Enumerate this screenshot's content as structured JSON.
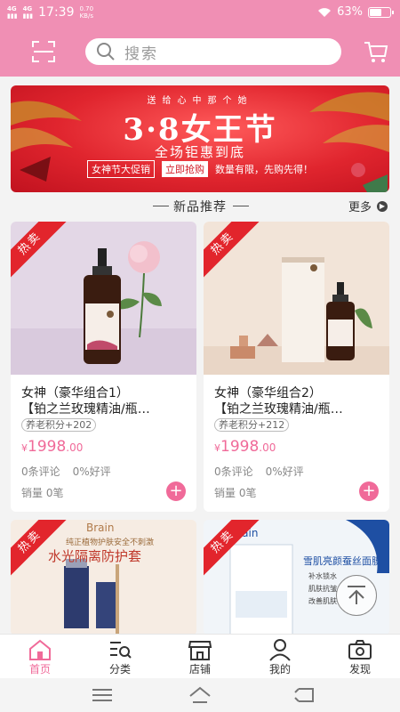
{
  "status_bar": {
    "network1": "4G",
    "network2": "4G",
    "time": "17:39",
    "speed_value": "0.70",
    "speed_unit": "KB/s",
    "battery": "63%",
    "battery_level": 0.63
  },
  "header": {
    "search_placeholder": "搜索",
    "scan_icon": "scan-icon",
    "cart_icon": "cart-icon"
  },
  "banner": {
    "top_text": "送给心中那个她",
    "title": "3·8女王节",
    "subtitle": "全场钜惠到底",
    "promo_label": "女神节大促销",
    "buy_label": "立即抢购",
    "limit_text": "数量有限，先购先得！"
  },
  "section": {
    "title": "新品推荐",
    "more": "更多"
  },
  "products": [
    {
      "badge": "热卖",
      "name_line1": "女神（豪华组合1）",
      "name_line2": "【铂之兰玫瑰精油/瓶…",
      "points": "养老积分+202",
      "currency": "¥",
      "price_int": "1998",
      "price_dec": ".00",
      "comments": "0条评论",
      "good_rate": "0%好评",
      "sales": "销量 0笔"
    },
    {
      "badge": "热卖",
      "name_line1": "女神（豪华组合2）",
      "name_line2": "【铂之兰玫瑰精油/瓶…",
      "points": "养老积分+212",
      "currency": "¥",
      "price_int": "1998",
      "price_dec": ".00",
      "comments": "0条评论",
      "good_rate": "0%好评",
      "sales": "销量 0笔"
    }
  ],
  "bottom_cards": [
    {
      "badge": "热卖",
      "brand": "Brain",
      "line1": "纯正植物护肤安全不刺激",
      "headline": "水光隔离防护套"
    },
    {
      "badge": "热卖",
      "brand": "Brain",
      "headline": "雪肌亮颜蚕丝面膜",
      "bullets": [
        "补水锁水",
        "肌肤抗皱",
        "改善肌肤"
      ]
    }
  ],
  "tabs": [
    {
      "label": "首页",
      "icon": "home-icon"
    },
    {
      "label": "分类",
      "icon": "category-icon"
    },
    {
      "label": "店铺",
      "icon": "store-icon"
    },
    {
      "label": "我的",
      "icon": "user-icon"
    },
    {
      "label": "发现",
      "icon": "camera-icon"
    }
  ],
  "colors": {
    "brand_pink": "#f08fb4",
    "price_pink": "#f06a99",
    "badge_red": "#e2252c"
  }
}
